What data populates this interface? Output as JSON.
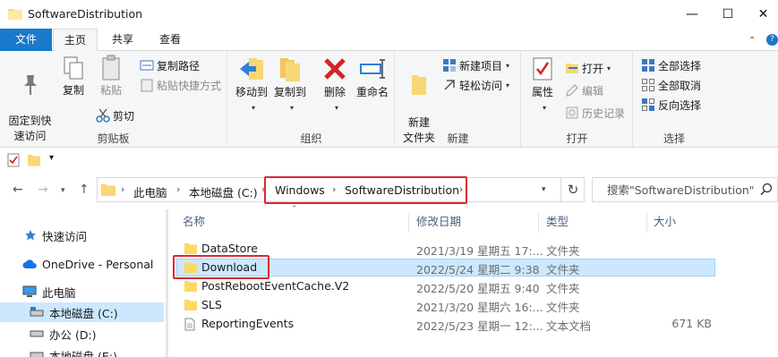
{
  "window": {
    "title": "SoftwareDistribution",
    "minimize": "—",
    "maximize": "☐",
    "close": "✕"
  },
  "ribbon_tabs": {
    "file": "文件",
    "home": "主页",
    "share": "共享",
    "view": "查看"
  },
  "ribbon": {
    "clipboard": {
      "label": "剪贴板",
      "pin": "固定到快\n速访问",
      "copy": "复制",
      "paste": "粘贴",
      "copy_path": "复制路径",
      "paste_shortcut": "粘贴快捷方式",
      "cut": "剪切"
    },
    "organize": {
      "label": "组织",
      "move_to": "移动到",
      "copy_to": "复制到",
      "delete": "删除",
      "rename": "重命名"
    },
    "new": {
      "label": "新建",
      "new_folder": "新建\n文件夹",
      "new_item": "新建项目",
      "easy_access": "轻松访问"
    },
    "open": {
      "label": "打开",
      "properties": "属性",
      "open": "打开",
      "edit": "编辑",
      "history": "历史记录"
    },
    "select": {
      "label": "选择",
      "select_all": "全部选择",
      "select_none": "全部取消",
      "invert": "反向选择"
    }
  },
  "address": {
    "crumbs": [
      "此电脑",
      "本地磁盘 (C:)",
      "Windows",
      "SoftwareDistribution"
    ],
    "search_placeholder": "搜索\"SoftwareDistribution\""
  },
  "nav_pane": [
    {
      "label": "快速访问",
      "icon": "star-icon"
    },
    {
      "label": "OneDrive - Personal",
      "icon": "cloud-icon"
    },
    {
      "label": "此电脑",
      "icon": "computer-icon"
    },
    {
      "label": "本地磁盘 (C:)",
      "icon": "drive-icon",
      "selected": true
    },
    {
      "label": "办公 (D:)",
      "icon": "drive-icon"
    },
    {
      "label": "本地磁盘 (E:)",
      "icon": "drive-icon"
    }
  ],
  "columns": {
    "name": "名称",
    "date": "修改日期",
    "type": "类型",
    "size": "大小"
  },
  "files": [
    {
      "name": "DataStore",
      "date": "2021/3/19 星期五 17:...",
      "type": "文件夹",
      "size": "",
      "kind": "folder"
    },
    {
      "name": "Download",
      "date": "2022/5/24 星期二 9:38",
      "type": "文件夹",
      "size": "",
      "kind": "folder",
      "selected": true
    },
    {
      "name": "PostRebootEventCache.V2",
      "date": "2022/5/20 星期五 9:40",
      "type": "文件夹",
      "size": "",
      "kind": "folder"
    },
    {
      "name": "SLS",
      "date": "2021/3/20 星期六 16:...",
      "type": "文件夹",
      "size": "",
      "kind": "folder"
    },
    {
      "name": "ReportingEvents",
      "date": "2022/5/23 星期一 12:...",
      "type": "文本文档",
      "size": "671 KB",
      "kind": "text"
    }
  ]
}
